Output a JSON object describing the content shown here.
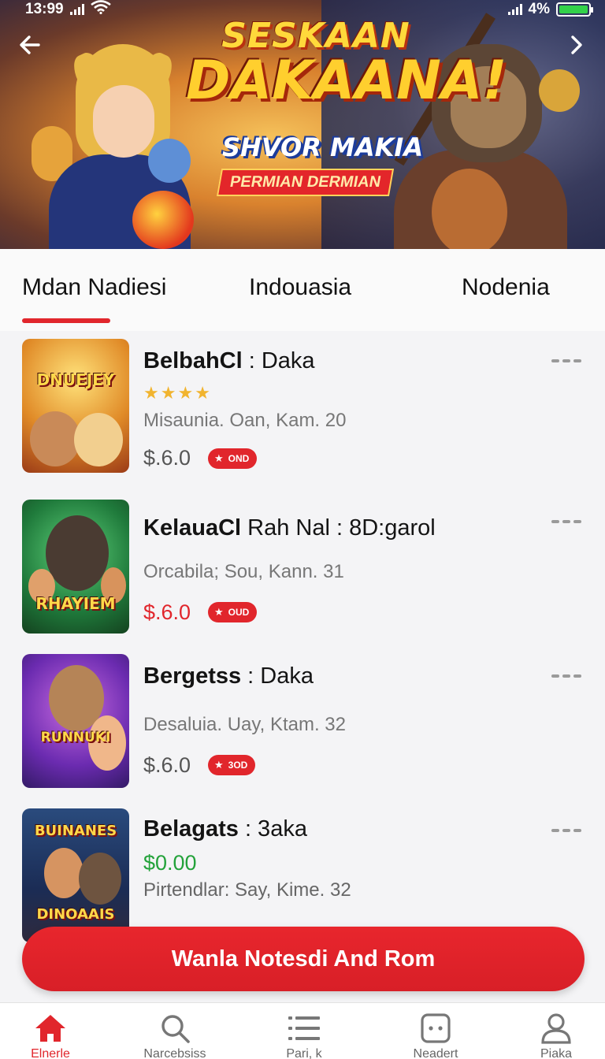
{
  "status_bar": {
    "time": "13:99",
    "battery": "4%"
  },
  "banner": {
    "title_line1": "SESKAAN",
    "title_line2": "DAKAANA!",
    "subtitle": "SHVOR MAKIA",
    "tag": "PERMIAN DERMIAN"
  },
  "tabs": [
    {
      "label": "Mdan Nadiesi",
      "active": true
    },
    {
      "label": "Indouasia",
      "active": false
    },
    {
      "label": "Nodenia",
      "active": false
    }
  ],
  "items": [
    {
      "title_bold": "BelbahCl",
      "title_rest": " : Daka",
      "rating": 4,
      "meta": "Misaunia. Oan,  Kam. 20",
      "price": "$.6.0",
      "price_color": "#555555",
      "badge": "OND",
      "thumb_title": "DNUEJEY"
    },
    {
      "title_bold": "KelauaCl",
      "title_rest": " Rah Nal : 8D:garol",
      "meta": "Orcabila; Sou,  Kann. 31",
      "price": "$.6.0",
      "price_color": "#e1262c",
      "badge": "OUD",
      "thumb_title": "RHAYIEM"
    },
    {
      "title_bold": "Bergetss",
      "title_rest": " : Daka",
      "meta": "Desaluia. Uay,  Ktam. 32",
      "price": "$.6.0",
      "price_color": "#555555",
      "badge": "3OD",
      "thumb_title": "RUNNUKI"
    },
    {
      "title_bold": "Belagats",
      "title_rest": " : 3aka",
      "meta": "Pirtendlar: Say,  Kime. 32",
      "price": "$0.00",
      "price_color": "#23a23a",
      "thumb_title_top": "BUINANES",
      "thumb_title": "DINOAAIS"
    }
  ],
  "cta": {
    "label": "Wanla  Notesdi And Rom"
  },
  "bottom_nav": [
    {
      "label": "Elnerle",
      "icon": "home-icon",
      "active": true
    },
    {
      "label": "Narcebsiss",
      "icon": "search-icon",
      "active": false
    },
    {
      "label": "Pari, k",
      "icon": "list-icon",
      "active": false
    },
    {
      "label": "Neadert",
      "icon": "dice-icon",
      "active": false
    },
    {
      "label": "Piaka",
      "icon": "profile-icon",
      "active": false
    }
  ],
  "colors": {
    "accent": "#e1262c",
    "star": "#f1b42f",
    "green_price": "#23a23a",
    "battery": "#33d14a"
  }
}
